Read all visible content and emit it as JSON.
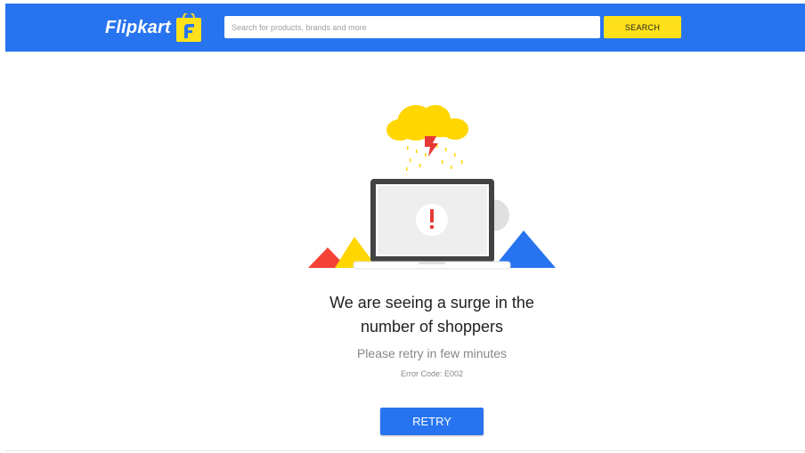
{
  "header": {
    "logo_text": "Flipkart",
    "logo_icon": "shopping-bag-icon",
    "search": {
      "placeholder": "Search for products, brands and more",
      "value": ""
    },
    "search_button_label": "SEARCH"
  },
  "error": {
    "illustration_icons": [
      "storm-cloud-icon",
      "lightning-bolt-icon",
      "laptop-icon",
      "warning-icon"
    ],
    "headline_line1": "We are seeing a surge in the",
    "headline_line2": "number of shoppers",
    "subtext": "Please retry in few minutes",
    "error_code": "Error Code: E002",
    "retry_label": "RETRY"
  },
  "colors": {
    "brand_blue": "#2874f0",
    "brand_yellow": "#ffe11b",
    "alert_red": "#e53935"
  }
}
